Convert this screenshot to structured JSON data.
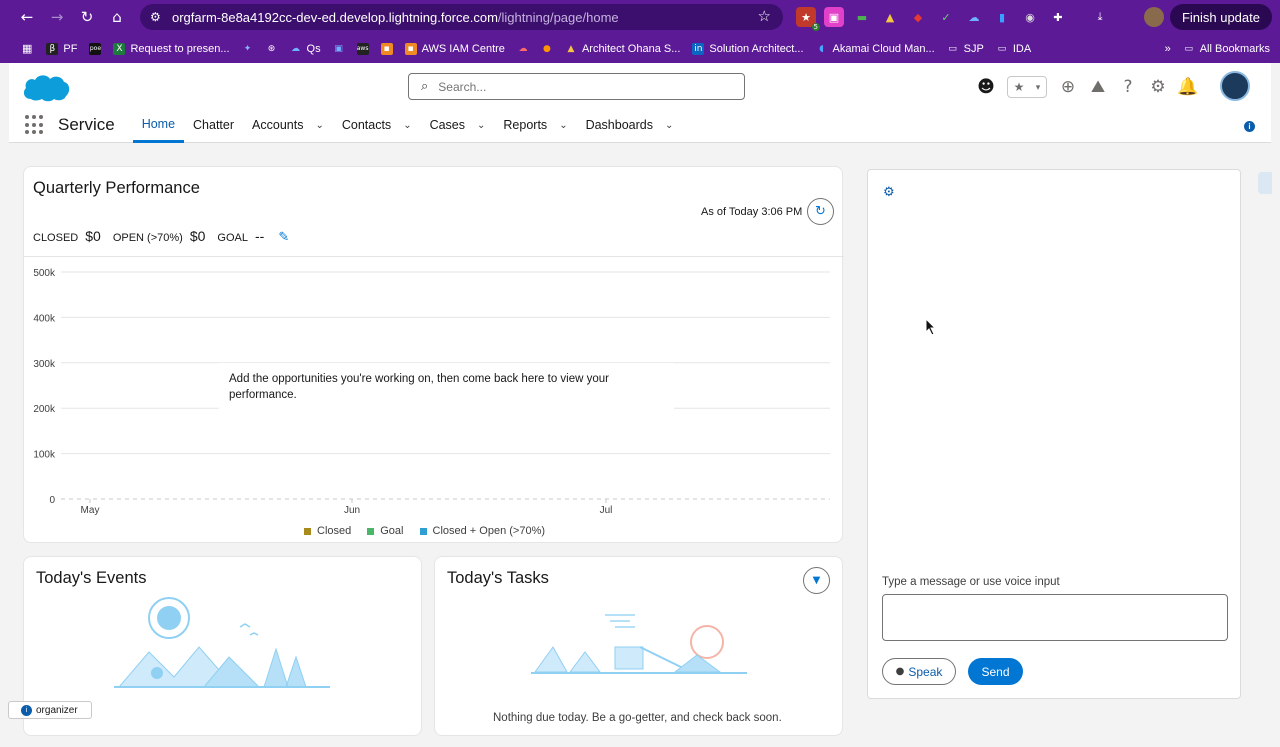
{
  "browser": {
    "url_host": "orgfarm-8e8a4192cc-dev-ed.develop.lightning.force.com",
    "url_path": "/lightning/page/home",
    "finish_update": "Finish update",
    "ext_badge": "5",
    "bookmarks": [
      "PF",
      "Request to presen...",
      "Qs",
      "AWS IAM Centre",
      "Architect Ohana S...",
      "Solution Architect...",
      "Akamai Cloud Man...",
      "SJP",
      "IDA"
    ],
    "all_bookmarks": "All Bookmarks",
    "more": "»"
  },
  "header": {
    "search_placeholder": "Search...",
    "app_name": "Service",
    "nav": [
      {
        "label": "Home",
        "active": true
      },
      {
        "label": "Chatter"
      },
      {
        "label": "Accounts"
      },
      {
        "label": "Contacts"
      },
      {
        "label": "Cases"
      },
      {
        "label": "Reports"
      },
      {
        "label": "Dashboards"
      }
    ]
  },
  "quarterly": {
    "title": "Quarterly Performance",
    "as_of": "As of Today 3:06 PM",
    "closed_label": "CLOSED",
    "closed_value": "$0",
    "open_label": "OPEN (>70%)",
    "open_value": "$0",
    "goal_label": "GOAL",
    "goal_value": "--",
    "empty_message": "Add the opportunities you're working on, then come back here to view your performance."
  },
  "chart_data": {
    "type": "line",
    "x": [
      "May",
      "Jun",
      "Jul"
    ],
    "y_ticks": [
      "0",
      "100k",
      "200k",
      "300k",
      "400k",
      "500k"
    ],
    "ylim": [
      0,
      500000
    ],
    "series": [
      {
        "name": "Closed",
        "values": [],
        "color": "#a98a1c"
      },
      {
        "name": "Goal",
        "values": [],
        "color": "#4bb66a"
      },
      {
        "name": "Closed + Open (>70%)",
        "values": [],
        "color": "#2e9fd0"
      }
    ],
    "grid": true,
    "legend": "bottom"
  },
  "events": {
    "title": "Today's Events"
  },
  "tasks": {
    "title": "Today's Tasks",
    "partial_text": "Nothing due today. Be a go-getter, and check back soon."
  },
  "chat": {
    "input_label": "Type a message or use voice input",
    "speak": "Speak",
    "send": "Send"
  },
  "organizer": {
    "label": "organizer"
  }
}
